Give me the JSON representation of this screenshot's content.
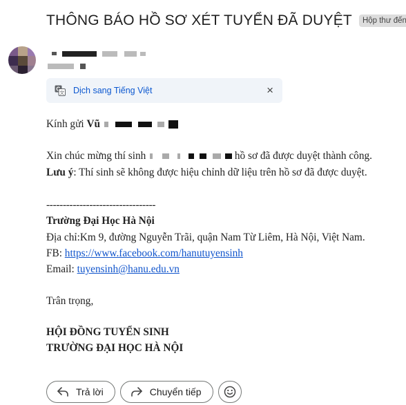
{
  "email": {
    "subject": "THÔNG BÁO HỒ SƠ XÉT TUYỂN ĐÃ DUYỆT",
    "label": "Hộp thư đến",
    "label_close": "×"
  },
  "translate": {
    "text": "Dịch sang Tiếng Việt",
    "close": "×",
    "icon": "translate-icon"
  },
  "message": {
    "greeting_prefix": "Kính gửi ",
    "greeting_name": "Vũ",
    "congrats_prefix": "Xin chúc mừng thí sinh ",
    "congrats_suffix": " hồ sơ đã được duyệt thành công.",
    "note_label": "Lưu ý",
    "note_text": ": Thí sinh sẽ không được hiệu chỉnh dữ liệu trên hồ sơ đã được duyệt.",
    "divider": "---------------------------------",
    "org_name": "Trường Đại Học Hà Nội",
    "address": "Địa chỉ:Km 9, đường Nguyễn Trãi, quận Nam Từ Liêm, Hà Nội, Việt Nam.",
    "fb_label": "FB: ",
    "fb_link": "https://www.facebook.com/hanutuyensinh",
    "email_label": "Email: ",
    "email_link": "tuyensinh@hanu.edu.vn",
    "closing": "Trân trọng,",
    "sign1": "HỘI ĐỒNG TUYỂN SINH",
    "sign2": "TRƯỜNG ĐẠI HỌC HÀ NỘI"
  },
  "actions": {
    "reply": "Trả lời",
    "forward": "Chuyển tiếp"
  }
}
